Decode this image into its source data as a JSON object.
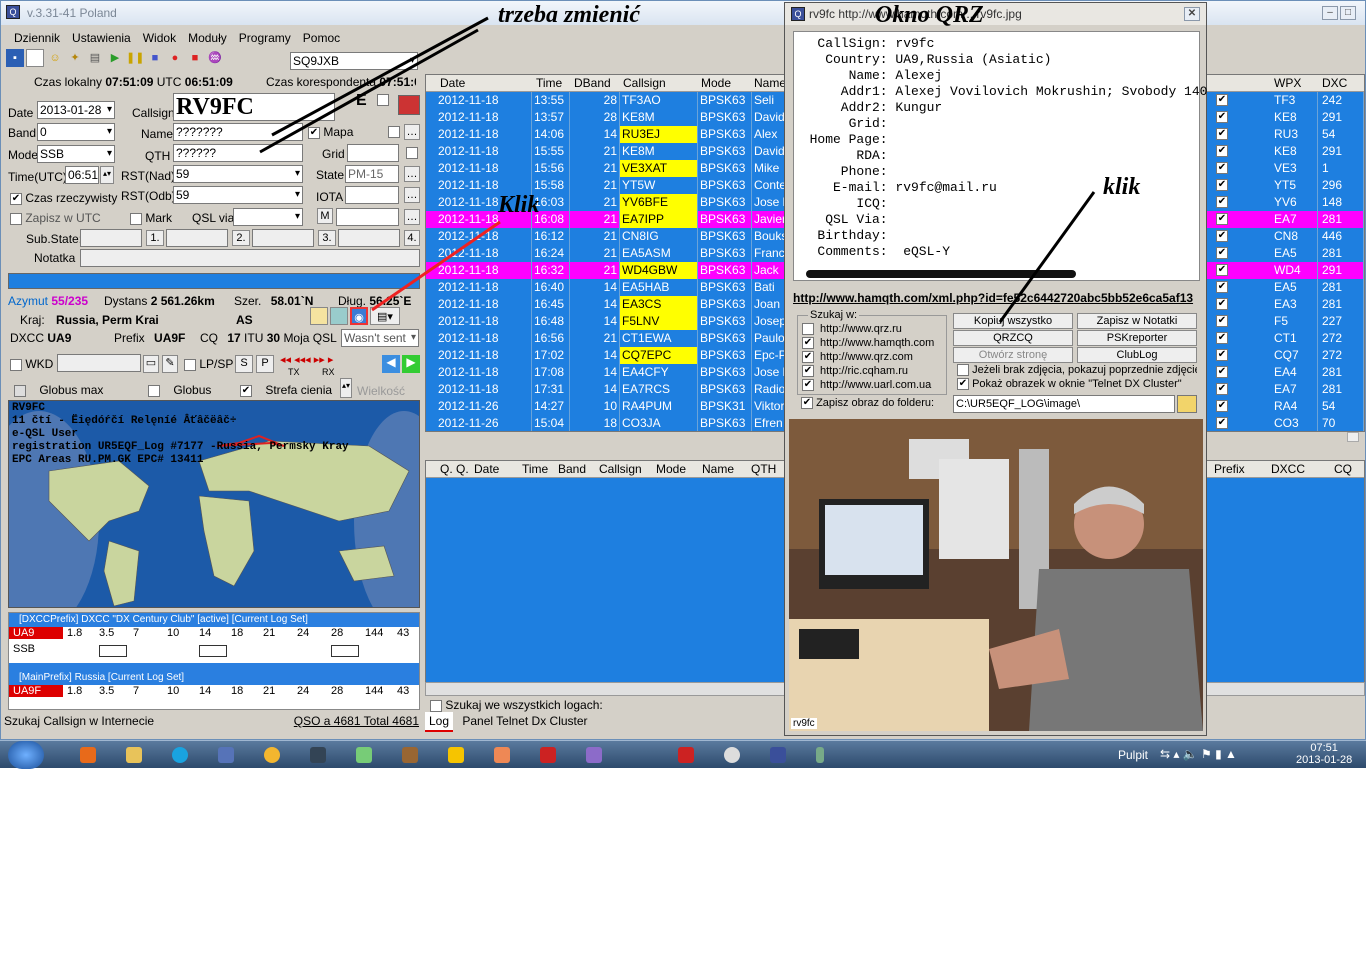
{
  "app": {
    "title": "v.3.31-41 Poland",
    "menu": [
      "Dziennik",
      "Ustawienia",
      "Widok",
      "Moduły",
      "Programy",
      "Pomoc"
    ],
    "callsign_field": "SQ9JXB"
  },
  "clock": {
    "local_label": "Czas lokalny",
    "local": "07:51:09",
    "utc_label": "UTC",
    "utc": "06:51:09",
    "corr_label": "Czas korespondenta",
    "corr": "07:51:09"
  },
  "form": {
    "date_label": "Date",
    "date": "2013-01-28",
    "callsign_label": "Callsign",
    "callsign": "RV9FC",
    "band_label": "Band",
    "band": "0",
    "name_label": "Name",
    "name": "???????",
    "mapa_label": "Mapa",
    "mode_label": "Mode",
    "mode": "SSB",
    "qth_label": "QTH",
    "qth": "??????",
    "grid_label": "Grid",
    "time_label": "Time(UTC)",
    "time": "06:51",
    "rstnad_label": "RST(Nad)",
    "rstnad": "59",
    "state_label": "State",
    "state": "PM-15",
    "czas_label": "Czas rzeczywisty",
    "rstodb_label": "RST(Odb)",
    "rstodb": "59",
    "iota_label": "IOTA",
    "zapisz_label": "Zapisz w UTC",
    "mark_label": "Mark",
    "qslvia_label": "QSL via",
    "m_btn": "M",
    "substate_label": "Sub.State:",
    "b1": "1.",
    "b2": "2.",
    "b3": "3.",
    "b4": "4.",
    "notatka_label": "Notatka",
    "e_label": "E"
  },
  "info": {
    "azymut_label": "Azymut",
    "azymut": "55/235",
    "dystans_label": "Dystans",
    "dystans": "2 561.26km",
    "szer_label": "Szer.",
    "szer": "58.01`N",
    "dlug_label": "Dług.",
    "dlug": "56.25`E",
    "kraj_label": "Kraj:",
    "kraj": "Russia, Perm Krai",
    "cont": "AS",
    "dxcc_label": "DXCC",
    "dxcc": "UA9",
    "prefix_label": "Prefix",
    "prefix": "UA9F",
    "cq_label": "CQ",
    "cq": "17",
    "itu_label": "ITU",
    "itu": "30",
    "mojaqsl_label": "Moja QSL",
    "mojaqsl": "Wasn't sent",
    "wkd_label": "WKD",
    "lpsp_label": "LP/SP",
    "s_btn": "S",
    "p_btn": "P",
    "tx": "TX",
    "rx": "RX",
    "globusmax": "Globus max",
    "globus": "Globus",
    "strefa": "Strefa cienia",
    "wielkosc": "Wielkość"
  },
  "qslinfo": [
    "RV9FC",
    "11 čtí - Ëiędóŕčí Relęníé Âťâčëâč÷",
    "e-QSL User",
    "registration UR5EQF_Log #7177 -Russia, Permsky Kray",
    "EPC Areas    RU.PM.GK   EPC# 13411"
  ],
  "dxcc_panel": {
    "title1": "[DXCCPrefix] DXCC \"DX Century Club\" [active] [Current Log Set]",
    "call1": "UA9",
    "bands": [
      "1.8",
      "3.5",
      "7",
      "10",
      "14",
      "18",
      "21",
      "24",
      "28",
      "144",
      "43"
    ],
    "mode1": "SSB",
    "title2": "[MainPrefix] Russia [Current Log Set]",
    "call2": "UA9F"
  },
  "status": {
    "search": "Szukaj Callsign w Internecie",
    "qso": "QSO a 4681 Total 4681"
  },
  "log": {
    "headers": [
      "Date",
      "Time",
      "DBand",
      "Callsign",
      "Mode",
      "Name"
    ],
    "rows": [
      [
        "2012-11-18",
        "13:55",
        "28",
        "TF3AO",
        "BPSK63",
        "Seli",
        "",
        "TF3",
        "242"
      ],
      [
        "2012-11-18",
        "13:57",
        "28",
        "KE8M",
        "BPSK63",
        "David",
        "",
        "KE8",
        "291"
      ],
      [
        "2012-11-18",
        "14:06",
        "14",
        "RU3EJ",
        "BPSK63",
        "Alex",
        "y",
        "RU3",
        "54"
      ],
      [
        "2012-11-18",
        "15:55",
        "21",
        "KE8M",
        "BPSK63",
        "David",
        "",
        "KE8",
        "291"
      ],
      [
        "2012-11-18",
        "15:56",
        "21",
        "VE3XAT",
        "BPSK63",
        "Mike",
        "y",
        "VE3",
        "1"
      ],
      [
        "2012-11-18",
        "15:58",
        "21",
        "YT5W",
        "BPSK63",
        "Conte",
        "",
        "YT5",
        "296"
      ],
      [
        "2012-11-18",
        "16:03",
        "21",
        "YV6BFE",
        "BPSK63",
        "Jose l",
        "y",
        "YV6",
        "148"
      ],
      [
        "2012-11-18",
        "16:08",
        "21",
        "EA7IPP",
        "BPSK63",
        "Javier",
        "m",
        "EA7",
        "281"
      ],
      [
        "2012-11-18",
        "16:12",
        "21",
        "CN8IG",
        "BPSK63",
        "Bouks",
        "",
        "CN8",
        "446"
      ],
      [
        "2012-11-18",
        "16:24",
        "21",
        "EA5ASM",
        "BPSK63",
        "Franc",
        "",
        "EA5",
        "281"
      ],
      [
        "2012-11-18",
        "16:32",
        "21",
        "WD4GBW",
        "BPSK63",
        "Jack",
        "m",
        "WD4",
        "291"
      ],
      [
        "2012-11-18",
        "16:40",
        "14",
        "EA5HAB",
        "BPSK63",
        "Bati",
        "",
        "EA5",
        "281"
      ],
      [
        "2012-11-18",
        "16:45",
        "14",
        "EA3CS",
        "BPSK63",
        "Joan",
        "y",
        "EA3",
        "281"
      ],
      [
        "2012-11-18",
        "16:48",
        "14",
        "F5LNV",
        "BPSK63",
        "Josep",
        "y",
        "F5",
        "227"
      ],
      [
        "2012-11-18",
        "16:56",
        "21",
        "CT1EWA",
        "BPSK63",
        "Paulo",
        "",
        "CT1",
        "272"
      ],
      [
        "2012-11-18",
        "17:02",
        "14",
        "CQ7EPC",
        "BPSK63",
        "Epc-P",
        "y",
        "CQ7",
        "272"
      ],
      [
        "2012-11-18",
        "17:08",
        "14",
        "EA4CFY",
        "BPSK63",
        "Jose l",
        "",
        "EA4",
        "281"
      ],
      [
        "2012-11-18",
        "17:31",
        "14",
        "EA7RCS",
        "BPSK63",
        "Radio",
        "",
        "EA7",
        "281"
      ],
      [
        "2012-11-26",
        "14:27",
        "10",
        "RA4PUM",
        "BPSK31",
        "Viktor",
        "",
        "RA4",
        "54"
      ],
      [
        "2012-11-26",
        "15:04",
        "18",
        "CO3JA",
        "BPSK63",
        "Efren",
        "",
        "CO3",
        "70"
      ]
    ],
    "right_headers": [
      "WPX",
      "DXC"
    ],
    "headers2": [
      "Q.",
      "Q.",
      "Date",
      "Time",
      "Band",
      "Callsign",
      "Mode",
      "Name",
      "QTH"
    ],
    "headers2_right": [
      "Prefix",
      "DXCC",
      "CQ"
    ],
    "search_all": "Szukaj we wszystkich logach:",
    "tab_log": "Log",
    "tab_telnet": "Panel Telnet Dx Cluster"
  },
  "qrz": {
    "title": "rv9fc http://www.hamqth.com/...rv9fc.jpg",
    "lines": [
      "CallSign: rv9fc",
      "Country: UA9,Russia (Asiatic)",
      "Name: Alexej",
      "Addr1: Alexej Vovilovich Mokrushin; Svobody 140",
      "Addr2: Kungur",
      "Grid:",
      "Home Page:",
      "RDA:",
      "Phone:",
      "E-mail: rv9fc@mail.ru",
      "ICQ:",
      "QSL Via:",
      "Birthday:",
      "Comments:  eQSL-Y"
    ],
    "url": "http://www.hamqth.com/xml.php?id=fe52c6442720abc5bb52e6ca5af13",
    "szukaj_label": "Szukaj w:",
    "sites": [
      "http://www.qrz.ru",
      "http://www.hamqth.com",
      "http://www.qrz.com",
      "http://ric.cqham.ru",
      "http://www.uarl.com.ua"
    ],
    "site_checked": [
      false,
      true,
      true,
      true,
      true
    ],
    "btn_copy": "Kopiuj wszystko",
    "btn_notes": "Zapisz w Notatki",
    "btn_qrzcq": "QRZCQ",
    "btn_psk": "PSKreporter",
    "btn_open": "Otwórz stronę",
    "btn_club": "ClubLog",
    "opt1": "Jeżeli brak zdjęcia, pokazuj poprzednie zdjęcie",
    "opt2": "Pokaż obrazek w oknie \"Telnet DX Cluster\"",
    "save_label": "Zapisz obraz do folderu:",
    "save_path": "C:\\UR5EQF_LOG\\image\\",
    "photo_caption": "rv9fc"
  },
  "annotations": {
    "a1": "trzeba zmienić",
    "a2": "Okno QRZ",
    "a3": "Klik",
    "a4": "klik"
  },
  "taskbar": {
    "pulpit": "Pulpit",
    "time": "07:51",
    "date": "2013-01-28"
  }
}
